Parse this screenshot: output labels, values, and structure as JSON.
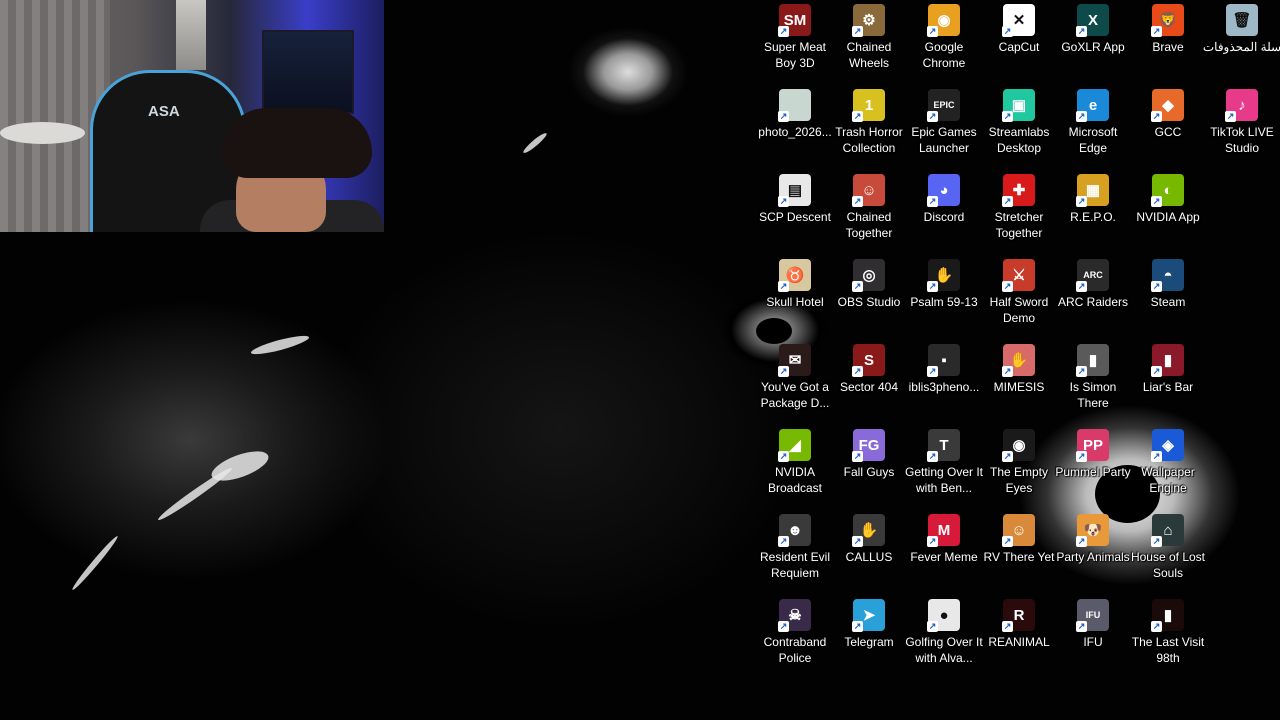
{
  "desktop": {
    "icons": [
      {
        "label": "Super Meat Boy 3D",
        "icon": "super-meat-boy-icon",
        "color": "#8a1a1a",
        "glyph": "SM"
      },
      {
        "label": "Chained Wheels",
        "icon": "chained-wheels-icon",
        "color": "#8a6a3a",
        "glyph": "⚙"
      },
      {
        "label": "Google Chrome",
        "icon": "chrome-icon",
        "color": "#e8a020",
        "glyph": "◉"
      },
      {
        "label": "CapCut",
        "icon": "capcut-icon",
        "color": "#ffffff",
        "glyph": "✕"
      },
      {
        "label": "GoXLR App",
        "icon": "goxlr-icon",
        "color": "#0e4a4a",
        "glyph": "X"
      },
      {
        "label": "Brave",
        "icon": "brave-icon",
        "color": "#e84a1a",
        "glyph": "🦁"
      },
      {
        "label": "سلة المحذوفات",
        "icon": "recycle-bin-icon",
        "color": "#9fb8c8",
        "glyph": "🗑"
      },
      {
        "label": "photo_2026...",
        "icon": "photo-file-icon",
        "color": "#c8d8d0",
        "glyph": ""
      },
      {
        "label": "Trash Horror Collection",
        "icon": "trash-horror-icon",
        "color": "#d8c020",
        "glyph": "1"
      },
      {
        "label": "Epic Games Launcher",
        "icon": "epic-games-icon",
        "color": "#222222",
        "glyph": "EPIC"
      },
      {
        "label": "Streamlabs Desktop",
        "icon": "streamlabs-icon",
        "color": "#20c8a0",
        "glyph": "▣"
      },
      {
        "label": "Microsoft Edge",
        "icon": "edge-icon",
        "color": "#1a8ad8",
        "glyph": "e"
      },
      {
        "label": "GCC",
        "icon": "gcc-icon",
        "color": "#e86a2a",
        "glyph": "◆"
      },
      {
        "label": "TikTok LIVE Studio",
        "icon": "tiktok-live-icon",
        "color": "#e83a8a",
        "glyph": "♪"
      },
      {
        "label": "SCP Descent",
        "icon": "scp-descent-icon",
        "color": "#e8e8e8",
        "glyph": "▤"
      },
      {
        "label": "Chained Together",
        "icon": "chained-together-icon",
        "color": "#c84a3a",
        "glyph": "☺"
      },
      {
        "label": "Discord",
        "icon": "discord-icon",
        "color": "#5865f2",
        "glyph": "◕"
      },
      {
        "label": "Stretcher Together",
        "icon": "stretcher-together-icon",
        "color": "#d81a1a",
        "glyph": "✚"
      },
      {
        "label": "R.E.P.O.",
        "icon": "repo-icon",
        "color": "#d8a020",
        "glyph": "▦"
      },
      {
        "label": "NVIDIA App",
        "icon": "nvidia-app-icon",
        "color": "#76b900",
        "glyph": "◐"
      },
      {
        "label": "",
        "icon": "blank-icon",
        "color": "transparent",
        "glyph": ""
      },
      {
        "label": "Skull Hotel",
        "icon": "skull-hotel-icon",
        "color": "#d8c8a0",
        "glyph": "♉"
      },
      {
        "label": "OBS Studio",
        "icon": "obs-icon",
        "color": "#302e31",
        "glyph": "◎"
      },
      {
        "label": "Psalm 59-13",
        "icon": "psalm-icon",
        "color": "#1a1a1a",
        "glyph": "✋"
      },
      {
        "label": "Half Sword Demo",
        "icon": "half-sword-icon",
        "color": "#c83a2a",
        "glyph": "⚔"
      },
      {
        "label": "ARC Raiders",
        "icon": "arc-raiders-icon",
        "color": "#2a2a2a",
        "glyph": "ARC"
      },
      {
        "label": "Steam",
        "icon": "steam-icon",
        "color": "#1b4b7a",
        "glyph": "◓"
      },
      {
        "label": "",
        "icon": "blank-icon",
        "color": "transparent",
        "glyph": ""
      },
      {
        "label": "You've Got a Package D...",
        "icon": "package-icon",
        "color": "#2a1a1a",
        "glyph": "✉"
      },
      {
        "label": "Sector 404",
        "icon": "sector-404-icon",
        "color": "#8a1a1a",
        "glyph": "S"
      },
      {
        "label": "iblis3pheno...",
        "icon": "iblis-icon",
        "color": "#2a2a2a",
        "glyph": "▪"
      },
      {
        "label": "MIMESIS",
        "icon": "mimesis-icon",
        "color": "#d86a6a",
        "glyph": "✋"
      },
      {
        "label": "Is Simon There",
        "icon": "is-simon-there-icon",
        "color": "#5a5a5a",
        "glyph": "▮"
      },
      {
        "label": "Liar's Bar",
        "icon": "liars-bar-icon",
        "color": "#8a1a2a",
        "glyph": "▮"
      },
      {
        "label": "",
        "icon": "blank-icon",
        "color": "transparent",
        "glyph": ""
      },
      {
        "label": "NVIDIA Broadcast",
        "icon": "nvidia-broadcast-icon",
        "color": "#76b900",
        "glyph": "◢"
      },
      {
        "label": "Fall Guys",
        "icon": "fall-guys-icon",
        "color": "#8a6ad8",
        "glyph": "FG"
      },
      {
        "label": "Getting Over It with Ben...",
        "icon": "getting-over-it-icon",
        "color": "#3a3a3a",
        "glyph": "T"
      },
      {
        "label": "The Empty Eyes",
        "icon": "empty-eyes-icon",
        "color": "#1a1a1a",
        "glyph": "◉"
      },
      {
        "label": "Pummel Party",
        "icon": "pummel-party-icon",
        "color": "#d83a6a",
        "glyph": "PP"
      },
      {
        "label": "Wallpaper Engine",
        "icon": "wallpaper-engine-icon",
        "color": "#1a5ad8",
        "glyph": "◈"
      },
      {
        "label": "",
        "icon": "blank-icon",
        "color": "transparent",
        "glyph": ""
      },
      {
        "label": "Resident Evil Requiem",
        "icon": "resident-evil-icon",
        "color": "#3a3a3a",
        "glyph": "☻"
      },
      {
        "label": "CALLUS",
        "icon": "callus-icon",
        "color": "#3a3a3a",
        "glyph": "✋"
      },
      {
        "label": "Fever Meme",
        "icon": "fever-meme-icon",
        "color": "#d81a3a",
        "glyph": "M"
      },
      {
        "label": "RV There Yet",
        "icon": "rv-there-yet-icon",
        "color": "#d88a3a",
        "glyph": "☺"
      },
      {
        "label": "Party Animals",
        "icon": "party-animals-icon",
        "color": "#e89a3a",
        "glyph": "🐶"
      },
      {
        "label": "House of Lost Souls",
        "icon": "house-of-lost-souls-icon",
        "color": "#2a3a3a",
        "glyph": "⌂"
      },
      {
        "label": "",
        "icon": "blank-icon",
        "color": "transparent",
        "glyph": ""
      },
      {
        "label": "Contraband Police",
        "icon": "contraband-police-icon",
        "color": "#3a2a4a",
        "glyph": "☠"
      },
      {
        "label": "Telegram",
        "icon": "telegram-icon",
        "color": "#2aa0d8",
        "glyph": "➤"
      },
      {
        "label": "Golfing Over It with Alva...",
        "icon": "golfing-over-it-icon",
        "color": "#e8e8e8",
        "glyph": "●"
      },
      {
        "label": "REANIMAL",
        "icon": "reanimal-icon",
        "color": "#2a0a0a",
        "glyph": "R"
      },
      {
        "label": "IFU",
        "icon": "ifu-icon",
        "color": "#5a5a6a",
        "glyph": "IFU"
      },
      {
        "label": "The Last Visit 98th",
        "icon": "last-visit-icon",
        "color": "#1a0a0a",
        "glyph": "▮"
      },
      {
        "label": "",
        "icon": "blank-icon",
        "color": "transparent",
        "glyph": ""
      }
    ]
  },
  "webcam": {
    "chair_logo": "ASA"
  }
}
